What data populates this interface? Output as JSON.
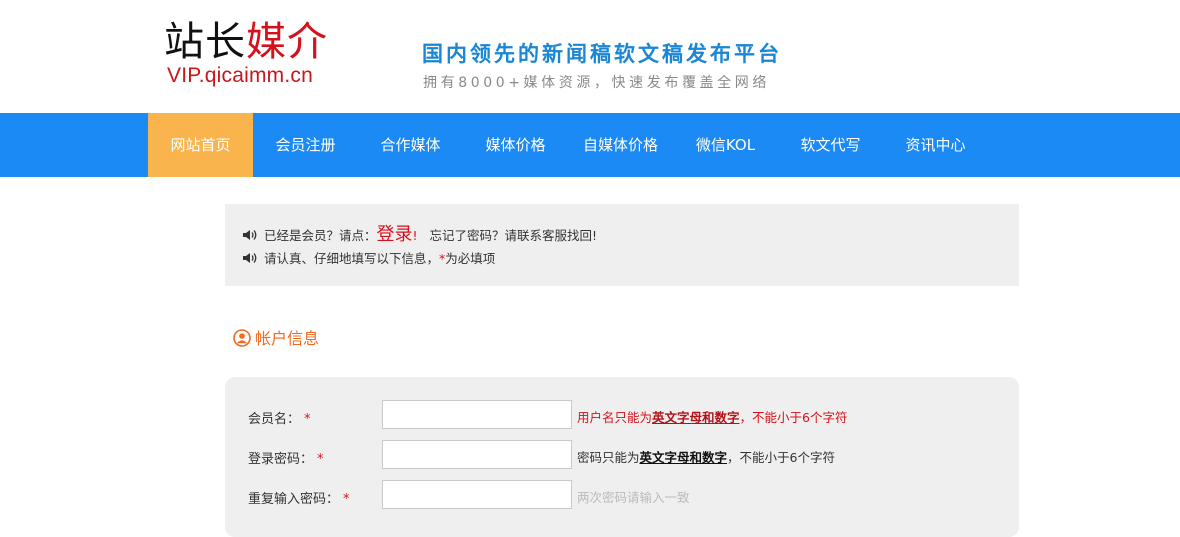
{
  "header": {
    "logo_black": "站长",
    "logo_red": "媒介",
    "logo_url": "VIP.qicaimm.cn",
    "slogan": "国内领先的新闻稿软文稿发布平台",
    "sub_slogan": "拥有8000+媒体资源，快速发布覆盖全网络"
  },
  "nav": {
    "items": [
      {
        "label": "网站首页",
        "active": true
      },
      {
        "label": "会员注册",
        "active": false
      },
      {
        "label": "合作媒体",
        "active": false
      },
      {
        "label": "媒体价格",
        "active": false
      },
      {
        "label": "自媒体价格",
        "active": false
      },
      {
        "label": "微信KOL",
        "active": false
      },
      {
        "label": "软文代写",
        "active": false
      },
      {
        "label": "资讯中心",
        "active": false
      }
    ]
  },
  "notice": {
    "line1_prefix": "已经是会员？请点：",
    "login_link": "登录",
    "line1_bang": "!",
    "line1_suffix": "忘记了密码？请联系客服找回!",
    "line2_prefix": "请认真、仔细地填写以下信息，",
    "line2_star": "*",
    "line2_suffix": "为必填项"
  },
  "section": {
    "title": "帐户信息"
  },
  "form": {
    "required_mark": "*",
    "fields": [
      {
        "label": "会员名：",
        "value": "",
        "placeholder": "",
        "hint_pre": "用户名只能为",
        "hint_bold": "英文字母和数字",
        "hint_post": "，不能小于6个字符"
      },
      {
        "label": "登录密码：",
        "value": "",
        "placeholder": "",
        "hint_pre": "密码只能为",
        "hint_bold": "英文字母和数字",
        "hint_post": "，不能小于6个字符"
      },
      {
        "label": "重复输入密码：",
        "value": "",
        "placeholder": "",
        "hint": "两次密码请输入一致"
      }
    ]
  },
  "colors": {
    "nav_bg": "#1b8af5",
    "nav_active": "#fab44d",
    "brand_red": "#d5121b",
    "slogan_blue": "#1a86d6",
    "section_orange": "#f06a1f"
  },
  "icons": {
    "speaker": "speaker-icon",
    "user": "user-circle-icon"
  }
}
